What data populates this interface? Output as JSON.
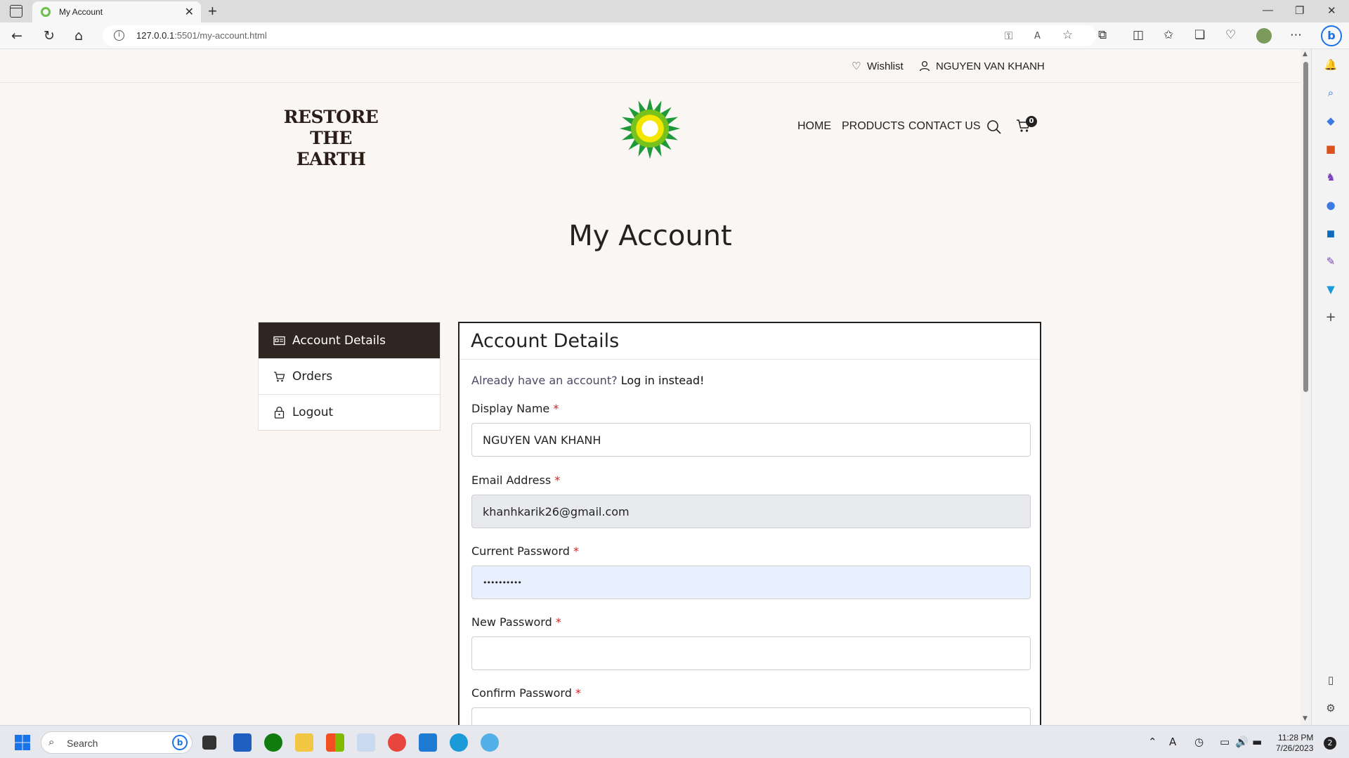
{
  "browser": {
    "tab_title": "My Account",
    "tab_close": "✕",
    "new_tab": "+",
    "url_host": "127.0.0.1",
    "url_path": ":5501/my-account.html",
    "window_controls": [
      "—",
      "❐",
      "✕"
    ]
  },
  "topbar": {
    "wishlist_label": "Wishlist",
    "user_name": "NGUYEN VAN KHANH"
  },
  "header": {
    "logo_line1": "RESTORE",
    "logo_line2": "THE EARTH",
    "menu": [
      "HOME",
      "PRODUCTS",
      "CONTACT US"
    ],
    "cart_count": "0"
  },
  "page_title": "My Account",
  "account_menu": [
    {
      "label": "Account Details",
      "icon": "id-card-icon",
      "active": true
    },
    {
      "label": "Orders",
      "icon": "cart-icon",
      "active": false
    },
    {
      "label": "Logout",
      "icon": "lock-icon",
      "active": false
    }
  ],
  "panel": {
    "heading": "Account Details",
    "already_q": "Already have an account?",
    "login_link": "Log in instead!",
    "required_mark": "*",
    "fields": [
      {
        "label": "Display Name",
        "value": "NGUYEN VAN KHANH"
      },
      {
        "label": "Email Address",
        "value": "khanhkarik26@gmail.com"
      },
      {
        "label": "Current Password",
        "value": "••••••••••"
      },
      {
        "label": "New Password",
        "value": ""
      },
      {
        "label": "Confirm Password",
        "value": ""
      }
    ]
  },
  "taskbar": {
    "search_placeholder": "Search",
    "time": "11:28 PM",
    "date": "7/26/2023",
    "notifications": "2"
  },
  "colors": {
    "page_bg": "#faf6f3",
    "active_menu_bg": "#2f2622",
    "required": "#d21f1f",
    "autofill_bg": "#e8f0fe",
    "readonly_bg": "#e8eaed"
  }
}
